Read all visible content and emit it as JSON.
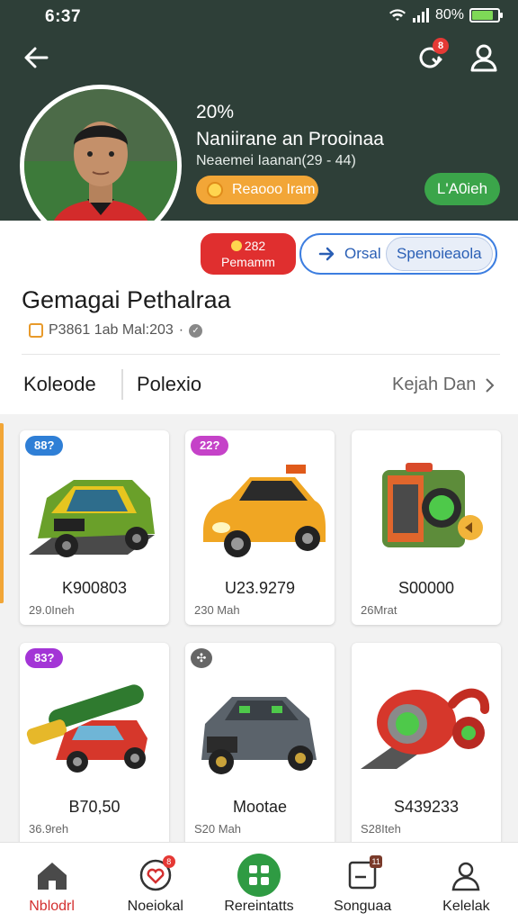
{
  "status_bar": {
    "time": "6:37",
    "battery_text": "80%"
  },
  "header": {
    "number": "20%",
    "name": "Naniirane an Prooinaa",
    "subtitle": "Neaemei Iaanan(29 - 44)",
    "orange_button": "Reaooo Iram",
    "green_button": "L'A0ieh",
    "notification_count": "8"
  },
  "actions": {
    "premium_top": "282",
    "premium_bottom": "Pemamm",
    "orsal_label": "Orsal",
    "spenoieaola_label": "Spenoieaola"
  },
  "page": {
    "title": "Gemagai Pethalraa",
    "meta": "P3861 1ab Mal:203"
  },
  "tabs": {
    "tab1": "Koleode",
    "tab2": "Polexio",
    "see_all": "Kejah Dan"
  },
  "cards": [
    {
      "badge": "88?",
      "badge_color": "#2f7fd6",
      "price": "K900803",
      "sub": "29.0Ineh",
      "icon": "green-truck-icon"
    },
    {
      "badge": "22?",
      "badge_color": "#c542c8",
      "price": "U23.9279",
      "sub": "230 Mah",
      "icon": "orange-car-icon"
    },
    {
      "badge": "",
      "badge_color": "",
      "price": "S00000",
      "sub": "26Mrat",
      "icon": "speaker-box-icon"
    },
    {
      "badge": "83?",
      "badge_color": "#a335d6",
      "price": "B70,50",
      "sub": "36.9reh",
      "icon": "red-cannon-truck-icon"
    },
    {
      "badge": "✣",
      "badge_color": "#666666",
      "price": "Mootae",
      "sub": "S20 Mah",
      "icon": "gray-armored-car-icon"
    },
    {
      "badge": "",
      "badge_color": "",
      "price": "S439233",
      "sub": "S28Iteh",
      "icon": "red-vacuum-gadget-icon"
    }
  ],
  "bottom_nav": [
    {
      "label": "Nblodrl",
      "icon": "home-icon",
      "active": true
    },
    {
      "label": "Noeiokal",
      "icon": "heart-icon",
      "badge": "8"
    },
    {
      "label": "Rereintatts",
      "icon": "grid-icon"
    },
    {
      "label": "Songuaa",
      "icon": "document-icon",
      "badge": "11"
    },
    {
      "label": "Kelelak",
      "icon": "user-icon"
    }
  ],
  "colors": {
    "header_bg": "#2e3f38",
    "accent_orange": "#f2a637",
    "accent_green": "#3ba54a",
    "premium_red": "#e02f2f",
    "link_blue": "#3d7ee0"
  }
}
